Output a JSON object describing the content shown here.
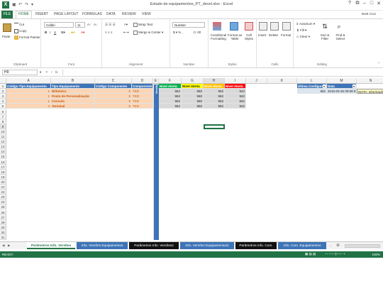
{
  "window": {
    "title": "Estado de equipamentos_PT_devel.xlsx - Excel",
    "user": "Brett Cruz",
    "help": "?",
    "restore": "⧉",
    "minimize": "–",
    "maximize": "□",
    "close": "✕"
  },
  "ribbon_tabs": {
    "file": "FILE",
    "home": "HOME",
    "insert": "INSERT",
    "page_layout": "PAGE LAYOUT",
    "formulas": "FORMULAS",
    "data": "DATA",
    "review": "REVIEW",
    "view": "VIEW"
  },
  "ribbon": {
    "clipboard": {
      "label": "Clipboard",
      "paste": "Paste",
      "cut": "Cut",
      "copy": "Copy",
      "format_painter": "Format Painter"
    },
    "font": {
      "label": "Font",
      "name": "Calibri",
      "size": "11",
      "bold": "B",
      "italic": "I",
      "underline": "U"
    },
    "alignment": {
      "label": "Alignment",
      "wrap": "Wrap Text",
      "merge": "Merge & Center"
    },
    "number": {
      "label": "Number",
      "format": "Number"
    },
    "styles": {
      "label": "Styles",
      "conditional": "Conditional Formatting",
      "format_table": "Format as Table",
      "cell_styles": "Cell Styles"
    },
    "cells": {
      "label": "Cells",
      "insert": "Insert",
      "delete": "Delete",
      "format": "Format"
    },
    "editing": {
      "label": "Editing",
      "autosum": "AutoSum",
      "fill": "Fill",
      "clear": "Clear",
      "sort": "Sort & Filter",
      "find": "Find & Select"
    }
  },
  "formula_bar": {
    "namebox": "H9",
    "fx": "fx",
    "cancel": "✕",
    "confirm": "✓"
  },
  "columns": [
    "A",
    "B",
    "C",
    "D",
    "E",
    "F",
    "G",
    "H",
    "I",
    "J",
    "K",
    "L",
    "M",
    "N"
  ],
  "rows": [
    "1",
    "2",
    "3",
    "4",
    "5",
    "6",
    "7",
    "8",
    "9",
    "10",
    "11",
    "12",
    "13",
    "14",
    "15",
    "16",
    "17",
    "18",
    "19",
    "20",
    "21",
    "22",
    "23",
    "24",
    "25",
    "26",
    "27",
    "28",
    "29",
    "30",
    "31"
  ],
  "headers": {
    "a": "Código Tipo Equipamento",
    "b": "Tipo Equipamento",
    "c": "Código Componente",
    "d": "Componente",
    "e": "Versão",
    "f": "Nível Alerta",
    "g": "Nível Alerta",
    "h": "Nível Alerta",
    "i": "Nível Alerta",
    "l": "Última Configuração",
    "m": "Data"
  },
  "table_rows": [
    {
      "a": "1",
      "b": "Bilheteira",
      "c": "5",
      "d": "TKD",
      "f": "962",
      "g": "960",
      "h": "952",
      "i": "942"
    },
    {
      "a": "1",
      "b": "Posto de Personalização",
      "c": "5",
      "d": "TKD",
      "f": "962",
      "g": "960",
      "h": "952",
      "i": "942"
    },
    {
      "a": "1",
      "b": "Consola",
      "c": "5",
      "d": "TKD",
      "f": "962",
      "g": "960",
      "h": "952",
      "i": "942"
    },
    {
      "a": "4",
      "b": "Terminal",
      "c": "5",
      "d": "TKD",
      "f": "962",
      "g": "960",
      "h": "952",
      "i": "942"
    }
  ],
  "config": {
    "value": "962",
    "date": "2016-03-26 00:59:31",
    "note": "NOTA: Informação o"
  },
  "sheets": [
    "Parâmetros Info. Versões",
    "Info. Versões Equipamentos",
    "Parâmetros Info. Versões2",
    "Info. Versões Equipamentos2",
    "Parâmetros Info. Com.",
    "Info. Com. Equipamentos"
  ],
  "status": {
    "ready": "READY",
    "zoom": "100%"
  },
  "colors": {
    "excel_green": "#217346",
    "header_blue": "#3e74b7",
    "alert_green": "#00b050",
    "alert_yellow": "#ffff00",
    "alert_orange": "#ffc000",
    "alert_red": "#ff0000",
    "row_orange": "#fbd5b5"
  }
}
